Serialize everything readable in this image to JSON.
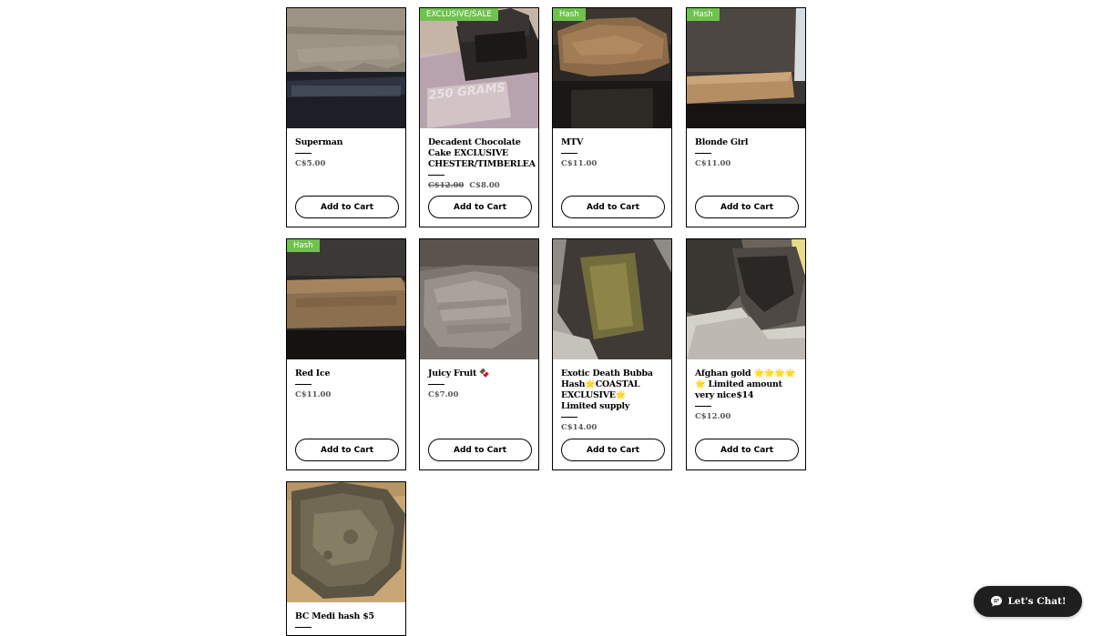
{
  "products": [
    {
      "name": "Superman",
      "price": "C$5.00",
      "old_price": null,
      "ribbon": null,
      "image": "superman-hash-photo",
      "button": "Add to Cart"
    },
    {
      "name": "Decadent Chocolate Cake EXCLUSIVE CHESTER/TIMBERLEA",
      "price": "C$8.00",
      "old_price": "C$12.00",
      "ribbon": "EXCLUSIVE/SALE",
      "image": "chocolate-cake-hash-photo",
      "button": "Add to Cart"
    },
    {
      "name": "MTV",
      "price": "C$11.00",
      "old_price": null,
      "ribbon": "Hash",
      "image": "mtv-hash-photo",
      "button": "Add to Cart"
    },
    {
      "name": "Blonde Girl",
      "price": "C$11.00",
      "old_price": null,
      "ribbon": "Hash",
      "image": "blonde-girl-hash-photo",
      "button": "Add to Cart"
    },
    {
      "name": "Red Ice",
      "price": "C$11.00",
      "old_price": null,
      "ribbon": "Hash",
      "image": "red-ice-hash-photo",
      "button": "Add to Cart"
    },
    {
      "name": "Juicy Fruit 🍫",
      "price": "C$7.00",
      "old_price": null,
      "ribbon": null,
      "image": "juicy-fruit-hash-photo",
      "button": "Add to Cart"
    },
    {
      "name": "Exotic Death Bubba Hash🌟COASTAL EXCLUSIVE🌟 Limited supply",
      "price": "C$14.00",
      "old_price": null,
      "ribbon": null,
      "image": "exotic-death-bubba-hash-photo",
      "button": "Add to Cart"
    },
    {
      "name": "Afghan gold 🌟🌟🌟🌟🌟 Limited amount very nice$14",
      "price": "C$12.00",
      "old_price": null,
      "ribbon": null,
      "image": "afghan-gold-hash-photo",
      "button": "Add to Cart"
    },
    {
      "name": "BC Medi hash $5",
      "price": "",
      "old_price": null,
      "ribbon": null,
      "image": "bc-medi-hash-photo",
      "button": ""
    }
  ],
  "chat": {
    "label": "Let's Chat!",
    "icon": "chat-bubble-icon"
  },
  "colors": {
    "ribbon": "#6fc24e",
    "chat_bg": "#1f1f1f",
    "price_text": "#555555"
  }
}
